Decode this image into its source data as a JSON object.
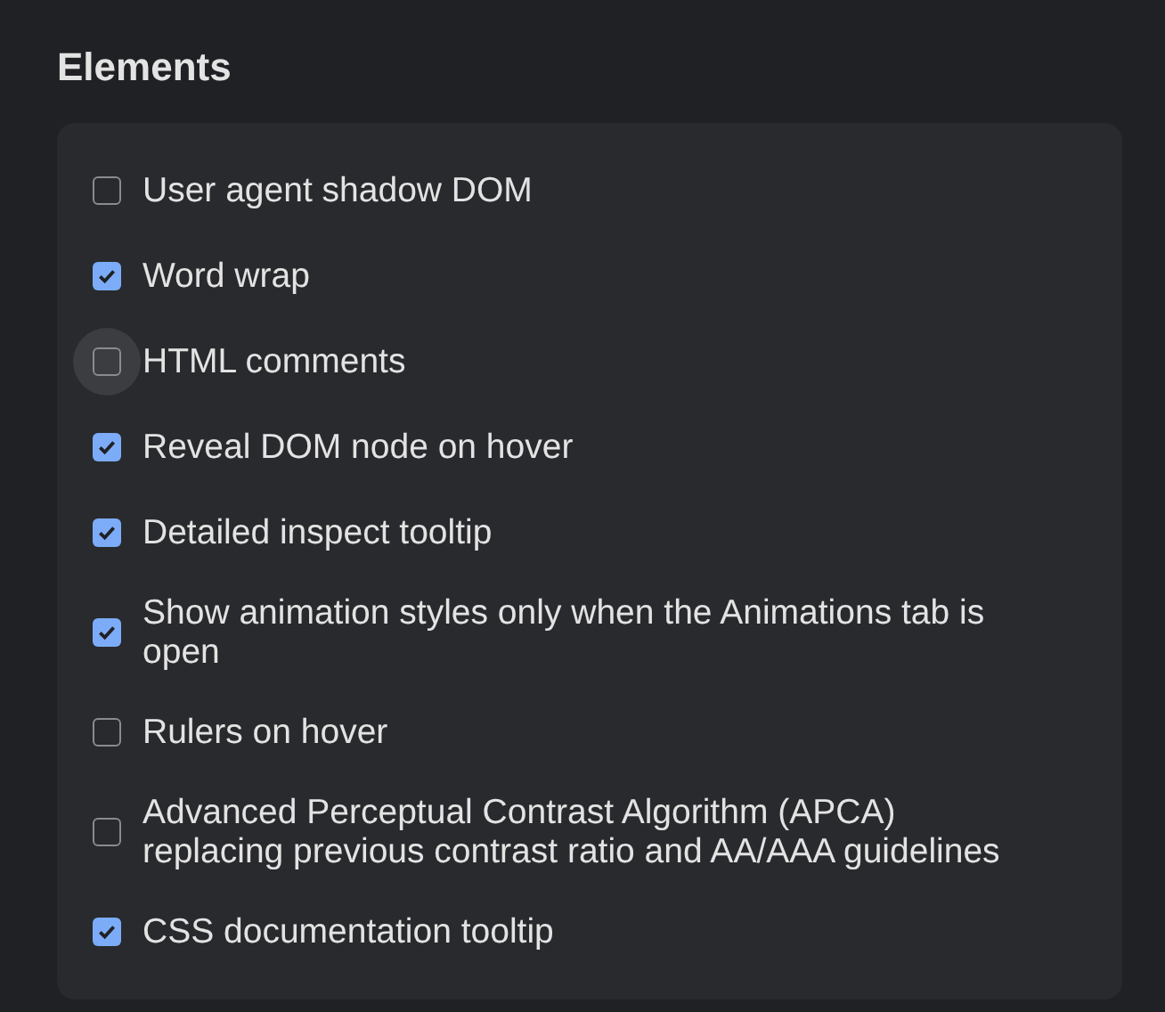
{
  "section": {
    "title": "Elements"
  },
  "options": [
    {
      "label": "User agent shadow DOM",
      "checked": false,
      "focused": false
    },
    {
      "label": "Word wrap",
      "checked": true,
      "focused": false
    },
    {
      "label": "HTML comments",
      "checked": false,
      "focused": true
    },
    {
      "label": "Reveal DOM node on hover",
      "checked": true,
      "focused": false
    },
    {
      "label": "Detailed inspect tooltip",
      "checked": true,
      "focused": false
    },
    {
      "label": "Show animation styles only when the Animations tab is open",
      "checked": true,
      "focused": false
    },
    {
      "label": "Rulers on hover",
      "checked": false,
      "focused": false
    },
    {
      "label": "Advanced Perceptual Contrast Algorithm (APCA) replacing previous contrast ratio and AA/AAA guidelines",
      "checked": false,
      "focused": false
    },
    {
      "label": "CSS documentation tooltip",
      "checked": true,
      "focused": false
    }
  ]
}
